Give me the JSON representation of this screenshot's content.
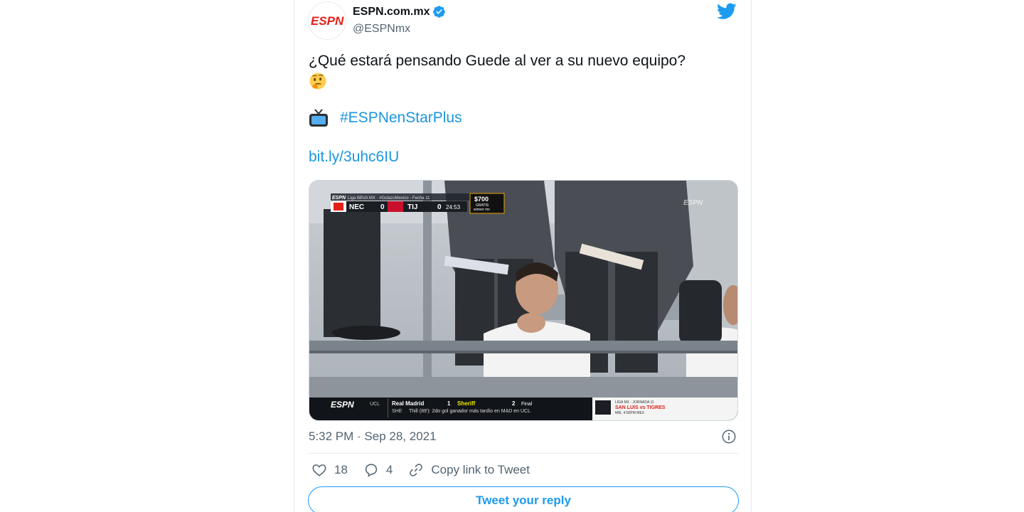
{
  "author": {
    "logo_text": "ESPN",
    "display_name": "ESPN.com.mx",
    "handle": "@ESPNmx",
    "verified": true
  },
  "tweet": {
    "text": "¿Qué estará pensando Guede al ver a su nuevo equipo?",
    "emoji_icon": "thinking-face-icon",
    "tv_icon": "television-icon",
    "hashtag": "#ESPNenStarPlus",
    "url": "bit.ly/3uhc6IU"
  },
  "media": {
    "scorebug": {
      "league": "Liga BBVA MX · #GolazoMexico - Fecha 11",
      "home_team": "NEC",
      "home_score": "0",
      "away_team": "TIJ",
      "away_score": "0",
      "clock": "24:53",
      "promo_amount": "$700",
      "promo_line1": "GRATIS",
      "promo_line2": "winner mx"
    },
    "ticker": {
      "network": "ESPN",
      "league": "UCL",
      "team1": "Real Madrid",
      "score1": "1",
      "team2": "Sheriff",
      "score2": "2",
      "status": "Final",
      "note_team": "SHE",
      "note": "Thill (89'): 2do gol ganador más tardío en MAD en UCL",
      "promo_title": "LIGA MX · JORNADA 11",
      "promo_match": "SAN LUIS vs TIGRES",
      "promo_time": "MIÉ. 4:50PM MEX"
    }
  },
  "meta": {
    "timestamp": "5:32 PM · Sep 28, 2021"
  },
  "actions": {
    "likes": "18",
    "replies": "4",
    "copy_link": "Copy link to Tweet"
  },
  "reply_button": "Tweet your reply",
  "colors": {
    "accent": "#1d9bf0",
    "link": "#1b95e0",
    "espn_red": "#e32119",
    "text_secondary": "#536471"
  }
}
